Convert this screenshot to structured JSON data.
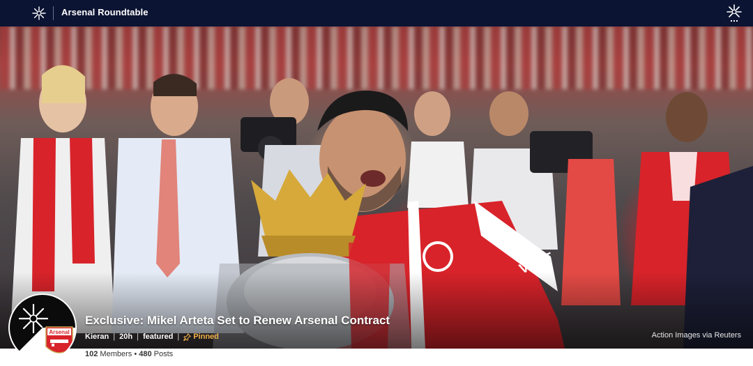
{
  "topbar": {
    "title": "Arsenal Roundtable",
    "left_icon": "sunburst-logo-icon",
    "right_icon": "sunburst-logo-icon"
  },
  "post": {
    "headline": "Exclusive: Mikel Arteta Set to Renew Arsenal Contract",
    "author": "Kieran",
    "time": "20h",
    "tag": "featured",
    "pinned_label": "Pinned",
    "photo_credit": "Action Images via Reuters"
  },
  "avatar": {
    "badge_text": "Arsenal"
  },
  "stats": {
    "members_count": "102",
    "members_label": "Members",
    "posts_count": "480",
    "posts_label": "Posts",
    "separator": "•"
  },
  "colors": {
    "topbar_bg": "#0c1433",
    "arsenal_red": "#d8232a",
    "pinned": "#f0b24a"
  }
}
